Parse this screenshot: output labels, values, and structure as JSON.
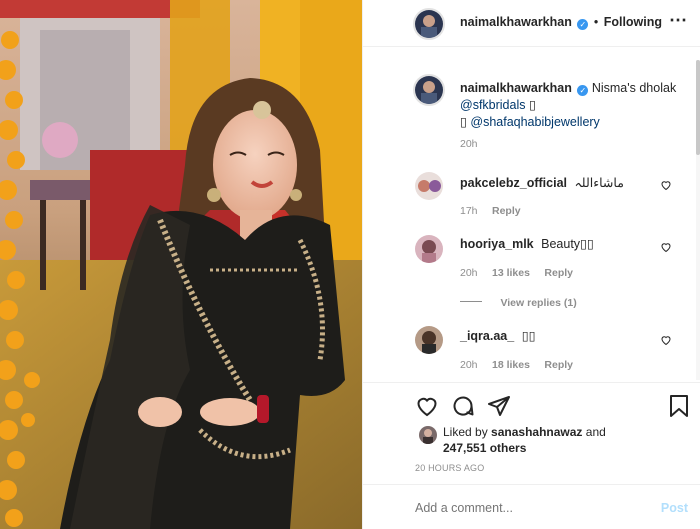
{
  "header": {
    "username": "naimalkhawarkhan",
    "separator": "•",
    "follow_state": "Following"
  },
  "caption": {
    "username": "naimalkhawarkhan",
    "text_before": "Nisma's dholak",
    "mention_1": "@sfkbridals",
    "glyph_1": "▯",
    "glyph_2": "▯",
    "mention_2": "@shafaqhabibjewellery",
    "time": "20h"
  },
  "comments": [
    {
      "username": "pakcelebz_official",
      "text": "ماشاءاللہ",
      "time": "17h",
      "likes": "",
      "reply": "Reply"
    },
    {
      "username": "hooriya_mlk",
      "text": "Beauty▯▯",
      "time": "20h",
      "likes": "13 likes",
      "reply": "Reply"
    },
    {
      "username": "_iqra.aa_",
      "text": "▯▯",
      "time": "20h",
      "likes": "18 likes",
      "reply": "Reply"
    }
  ],
  "view_replies": "View replies (1)",
  "likes": {
    "liked_by_prefix": "Liked by",
    "liked_by_user": "sanashahnawaz",
    "and": "and",
    "count": "247,551 others"
  },
  "timestamp": "20 HOURS AGO",
  "add_comment": {
    "placeholder": "Add a comment...",
    "post_label": "Post"
  },
  "colors": {
    "accent": "#3897f0",
    "link": "#00376b",
    "muted": "#8e8e8e",
    "post_disabled": "#b2dffc"
  },
  "icons": [
    "verified-icon",
    "heart-icon",
    "comment-icon",
    "share-icon",
    "bookmark-icon"
  ]
}
